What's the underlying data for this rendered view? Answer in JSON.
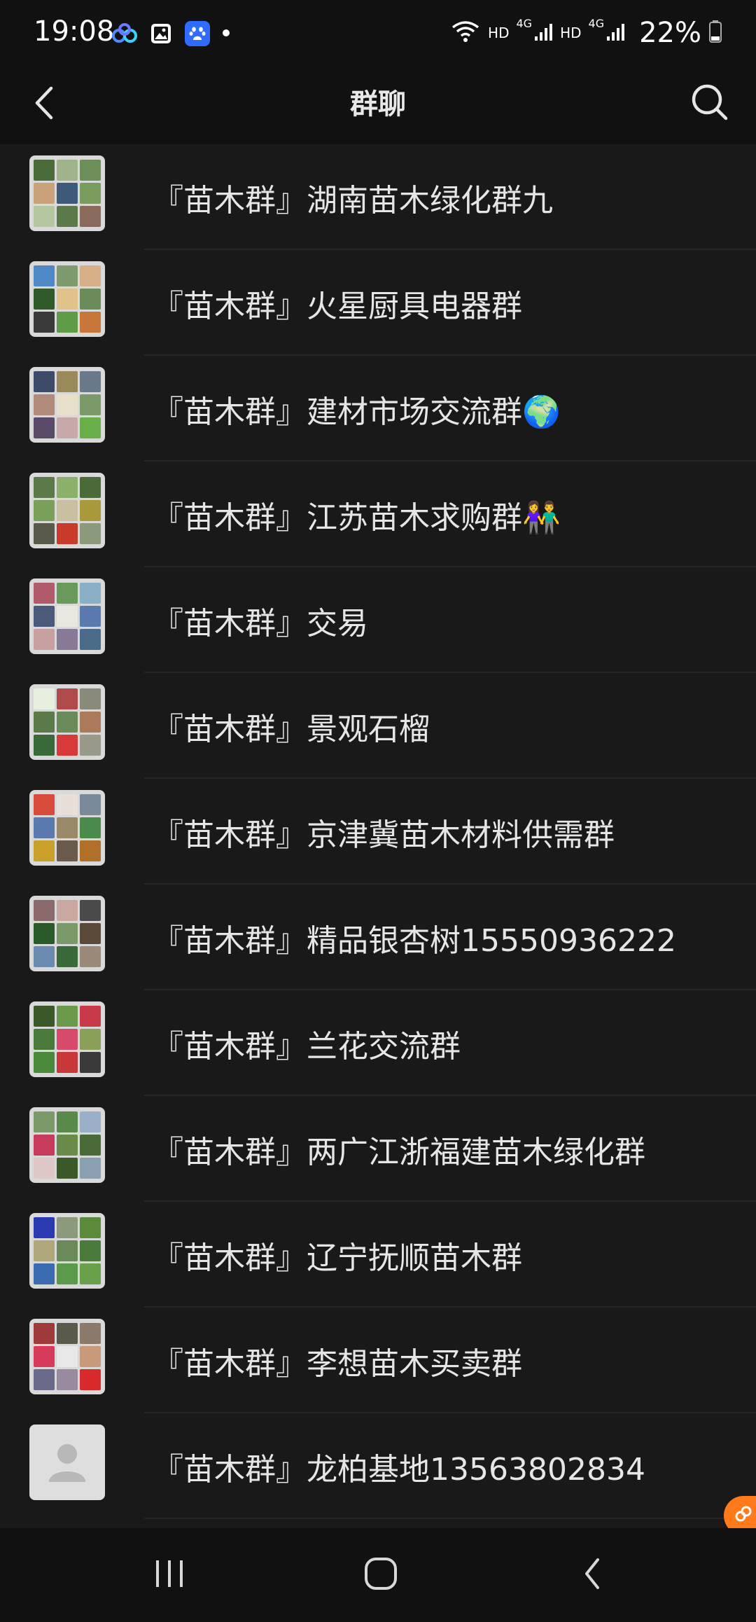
{
  "status_bar": {
    "time": "19:08",
    "network_1": "HD",
    "network_2": "HD",
    "signal_1": "4G",
    "signal_2": "4G",
    "battery": "22%",
    "icons": [
      "baidu-netdisk-icon",
      "gallery-icon",
      "baidu-icon",
      "notification-dot-icon",
      "wifi-icon",
      "signal-icon",
      "battery-icon"
    ]
  },
  "header": {
    "title": "群聊",
    "back_icon": "chevron-left-icon",
    "search_icon": "search-icon"
  },
  "groups": [
    {
      "name": "『苗木群』湖南苗木绿化群九"
    },
    {
      "name": "『苗木群』火星厨具电器群"
    },
    {
      "name": "『苗木群』建材市场交流群🌍"
    },
    {
      "name": "『苗木群』江苏苗木求购群👫"
    },
    {
      "name": "『苗木群』交易"
    },
    {
      "name": "『苗木群』景观石榴"
    },
    {
      "name": "『苗木群』京津冀苗木材料供需群"
    },
    {
      "name": "『苗木群』精品银杏树15550936222"
    },
    {
      "name": "『苗木群』兰花交流群"
    },
    {
      "name": "『苗木群』两广江浙福建苗木绿化群"
    },
    {
      "name": "『苗木群』辽宁抚顺苗木群"
    },
    {
      "name": "『苗木群』李想苗木买卖群"
    },
    {
      "name": "『苗木群』龙柏基地13563802834"
    }
  ],
  "colors": {
    "background": "#111111",
    "list_background": "#191919",
    "divider": "#262626",
    "text": "#e6e6e6",
    "accent": "#ff7a1a"
  }
}
